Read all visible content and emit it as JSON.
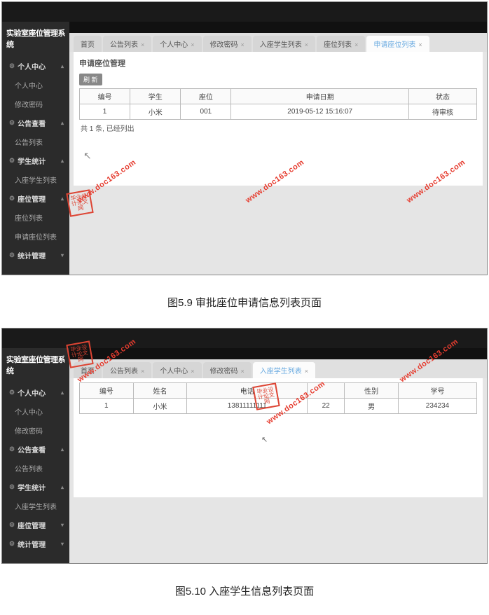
{
  "brand": "实验室座位管理系统",
  "sidebar1": {
    "items": [
      {
        "label": "个人中心",
        "type": "parent",
        "gear": true,
        "caret": "up"
      },
      {
        "label": "个人中心",
        "type": "child"
      },
      {
        "label": "修改密码",
        "type": "child"
      },
      {
        "label": "公告查看",
        "type": "parent",
        "gear": true,
        "caret": "up"
      },
      {
        "label": "公告列表",
        "type": "child"
      },
      {
        "label": "学生统计",
        "type": "parent",
        "gear": true,
        "caret": "up"
      },
      {
        "label": "入座学生列表",
        "type": "child"
      },
      {
        "label": "座位管理",
        "type": "parent",
        "gear": true,
        "caret": "up"
      },
      {
        "label": "座位列表",
        "type": "child"
      },
      {
        "label": "申请座位列表",
        "type": "child"
      },
      {
        "label": "统计管理",
        "type": "parent",
        "gear": true,
        "caret": "down"
      }
    ]
  },
  "sidebar2": {
    "items": [
      {
        "label": "个人中心",
        "type": "parent",
        "gear": true,
        "caret": "up"
      },
      {
        "label": "个人中心",
        "type": "child"
      },
      {
        "label": "修改密码",
        "type": "child"
      },
      {
        "label": "公告查看",
        "type": "parent",
        "gear": true,
        "caret": "up"
      },
      {
        "label": "公告列表",
        "type": "child"
      },
      {
        "label": "学生统计",
        "type": "parent",
        "gear": true,
        "caret": "up"
      },
      {
        "label": "入座学生列表",
        "type": "child"
      },
      {
        "label": "座位管理",
        "type": "parent",
        "gear": true,
        "caret": "down"
      },
      {
        "label": "统计管理",
        "type": "parent",
        "gear": true,
        "caret": "down"
      }
    ]
  },
  "tabs1": [
    {
      "label": "首页",
      "closable": false
    },
    {
      "label": "公告列表",
      "closable": true
    },
    {
      "label": "个人中心",
      "closable": true
    },
    {
      "label": "修改密码",
      "closable": true
    },
    {
      "label": "入座学生列表",
      "closable": true
    },
    {
      "label": "座位列表",
      "closable": true
    },
    {
      "label": "申请座位列表",
      "closable": true,
      "active": true
    }
  ],
  "tabs2": [
    {
      "label": "首页",
      "closable": false
    },
    {
      "label": "公告列表",
      "closable": true
    },
    {
      "label": "个人中心",
      "closable": true
    },
    {
      "label": "修改密码",
      "closable": true
    },
    {
      "label": "入座学生列表",
      "closable": true,
      "active": true
    }
  ],
  "panel1": {
    "title": "申请座位管理",
    "button": "刷 新",
    "headers": [
      "编号",
      "学生",
      "座位",
      "申请日期",
      "状态"
    ],
    "rows": [
      [
        "1",
        "小米",
        "001",
        "2019-05-12 15:16:07",
        "待审核"
      ]
    ],
    "footer": "共 1 条, 已经列出"
  },
  "panel2": {
    "headers": [
      "编号",
      "姓名",
      "电话",
      "性别",
      "学号"
    ],
    "rows": [
      [
        "1",
        "小米",
        "13811111111",
        "22",
        "男",
        "234234"
      ]
    ]
  },
  "caption1": "图5.9 审批座位申请信息列表页面",
  "caption2": "图5.10 入座学生信息列表页面",
  "watermark": "www.doc163.com",
  "stamp": "毕业设计论文网"
}
